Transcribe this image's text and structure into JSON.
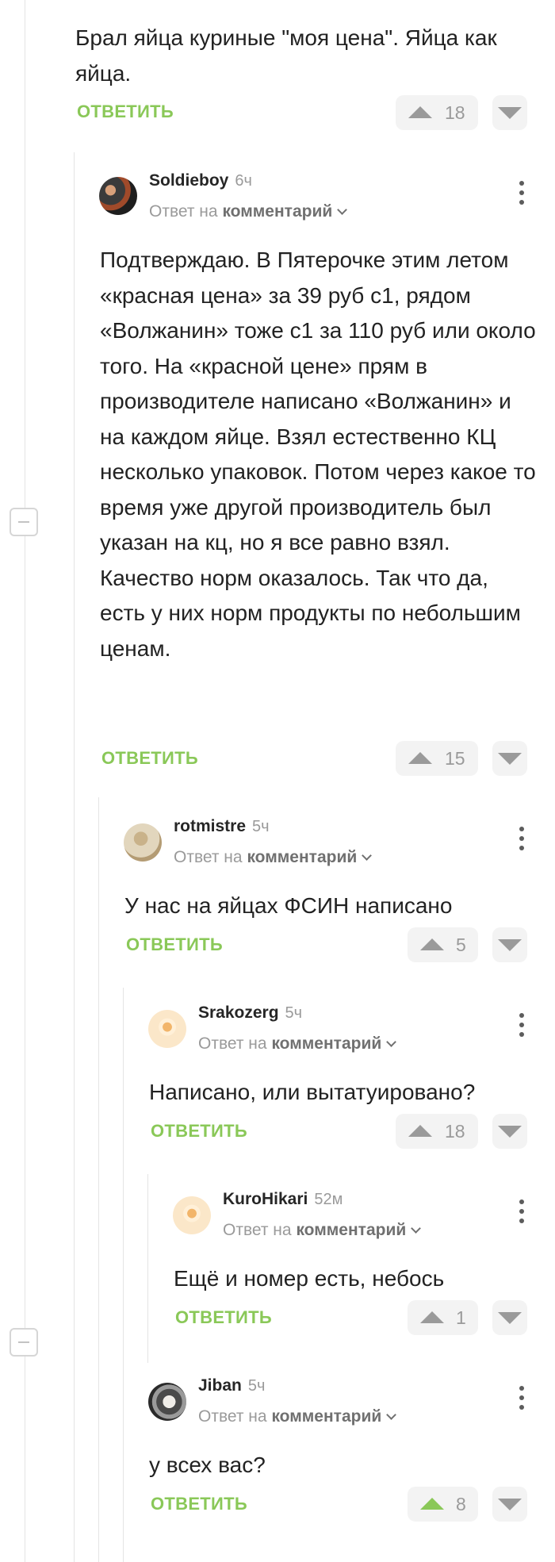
{
  "reply_label": "ОТВЕТИТЬ",
  "reply_to_prefix": "Ответ на",
  "reply_to_target": "комментарий",
  "comments": [
    {
      "text": "Брал яйца куриные \"моя цена\". Яйца как яйца.",
      "votes": "18"
    },
    {
      "author": "Soldieboy",
      "time": "6ч",
      "text": "Подтверждаю. В Пятерочке этим летом «красная цена» за 39 руб с1, рядом «Волжанин» тоже с1 за 110 руб или около того. На «красной цене» прям в производителе написано «Волжанин» и на каждом яйце. Взял естественно КЦ несколько упаковок. Потом через какое то время уже другой производитель был указан на кц, но я все равно взял. Качество норм оказалось. Так что да, есть у них норм продукты по небольшим ценам.",
      "votes": "15"
    },
    {
      "author": "rotmistre",
      "time": "5ч",
      "text": "У нас на яйцах ФСИН написано",
      "votes": "5"
    },
    {
      "author": "Srakozerg",
      "time": "5ч",
      "text": "Написано, или вытатуировано?",
      "votes": "18"
    },
    {
      "author": "KuroHikari",
      "time": "52м",
      "text": "Ещё и номер есть, небось",
      "votes": "1"
    },
    {
      "author": "Jiban",
      "time": "5ч",
      "text": "у всех вас?",
      "votes": "8"
    }
  ],
  "colors": {
    "accent_green": "#8ac858",
    "muted_gray": "#9a9a9a"
  }
}
